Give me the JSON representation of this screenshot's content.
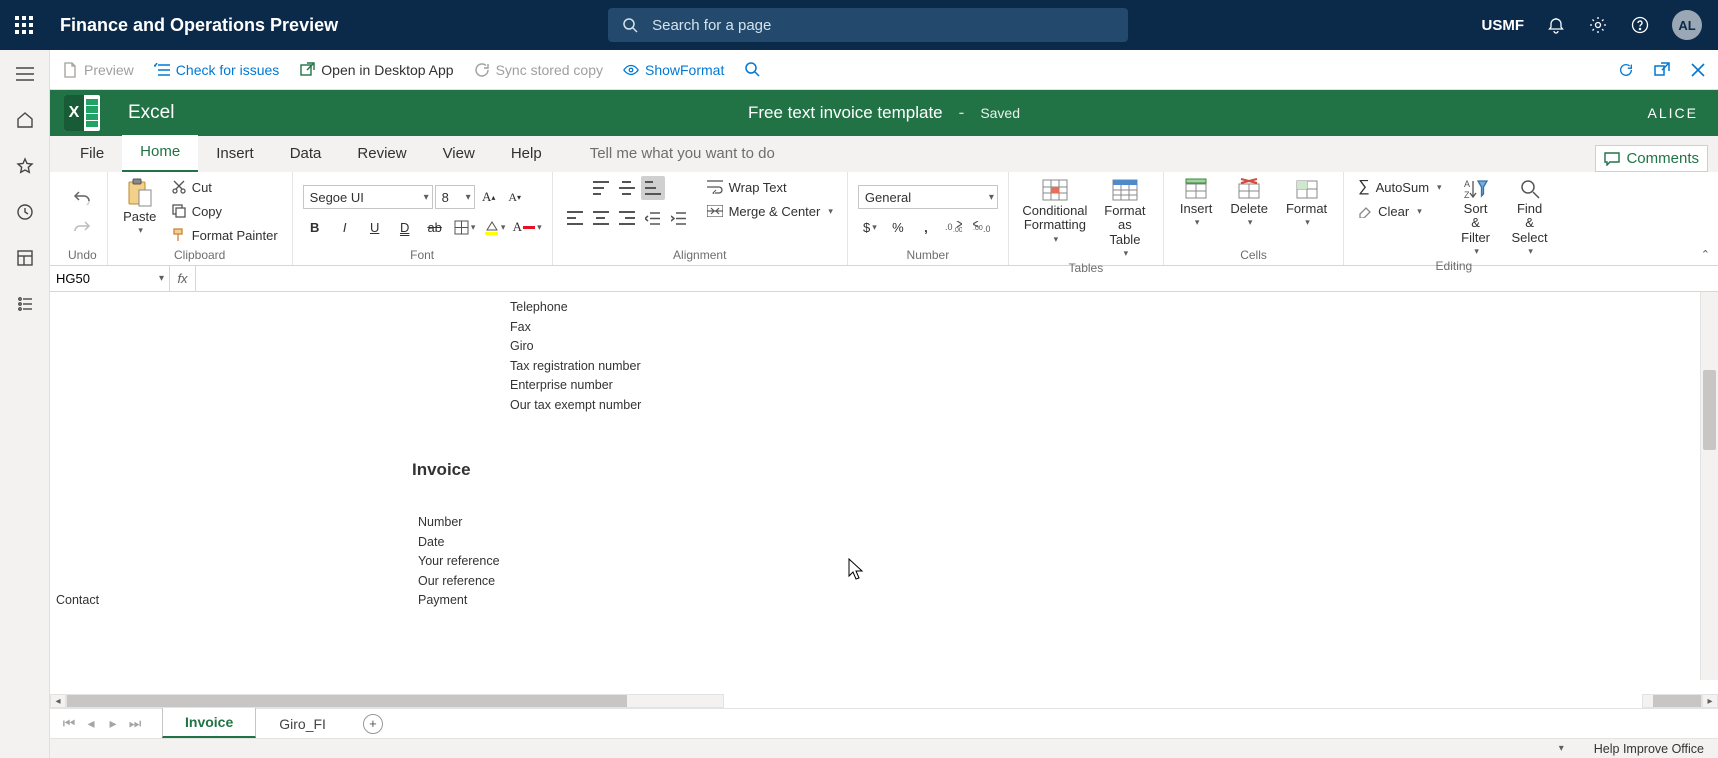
{
  "header": {
    "title": "Finance and Operations Preview",
    "search_placeholder": "Search for a page",
    "company": "USMF",
    "avatar": "AL"
  },
  "actions": {
    "preview": "Preview",
    "check_issues": "Check for issues",
    "open_desktop": "Open in Desktop App",
    "sync": "Sync stored copy",
    "show_format": "ShowFormat"
  },
  "excel": {
    "app_name": "Excel",
    "doc_title": "Free text invoice template",
    "separator": "-",
    "saved": "Saved",
    "user": "ALICE",
    "tabs": {
      "file": "File",
      "home": "Home",
      "insert": "Insert",
      "data": "Data",
      "review": "Review",
      "view": "View",
      "help": "Help",
      "tell_me": "Tell me what you want to do",
      "comments": "Comments"
    },
    "ribbon": {
      "undo": "Undo",
      "clipboard": {
        "label": "Clipboard",
        "paste": "Paste",
        "cut": "Cut",
        "copy": "Copy",
        "format_painter": "Format Painter"
      },
      "font": {
        "label": "Font",
        "family": "Segoe UI",
        "size": "8"
      },
      "alignment": {
        "label": "Alignment",
        "wrap": "Wrap Text",
        "merge": "Merge & Center"
      },
      "number": {
        "label": "Number",
        "format": "General"
      },
      "tables": {
        "label": "Tables",
        "cond": "Conditional Formatting",
        "as_table": "Format as Table"
      },
      "cells": {
        "label": "Cells",
        "insert": "Insert",
        "delete": "Delete",
        "format": "Format"
      },
      "editing": {
        "label": "Editing",
        "autosum": "AutoSum",
        "clear": "Clear",
        "sort": "Sort & Filter",
        "find": "Find & Select"
      }
    },
    "namebox": "HG50",
    "formula": "",
    "sheet_tabs": {
      "invoice": "Invoice",
      "giro": "Giro_FI"
    },
    "status_help": "Help Improve Office"
  },
  "cells": {
    "telephone": "Telephone",
    "fax": "Fax",
    "giro": "Giro",
    "tax_reg": "Tax registration number",
    "ent_num": "Enterprise number",
    "tax_exempt": "Our tax exempt number",
    "invoice_h": "Invoice",
    "number": "Number",
    "date": "Date",
    "your_ref": "Your reference",
    "our_ref": "Our reference",
    "payment": "Payment",
    "contact": "Contact"
  }
}
